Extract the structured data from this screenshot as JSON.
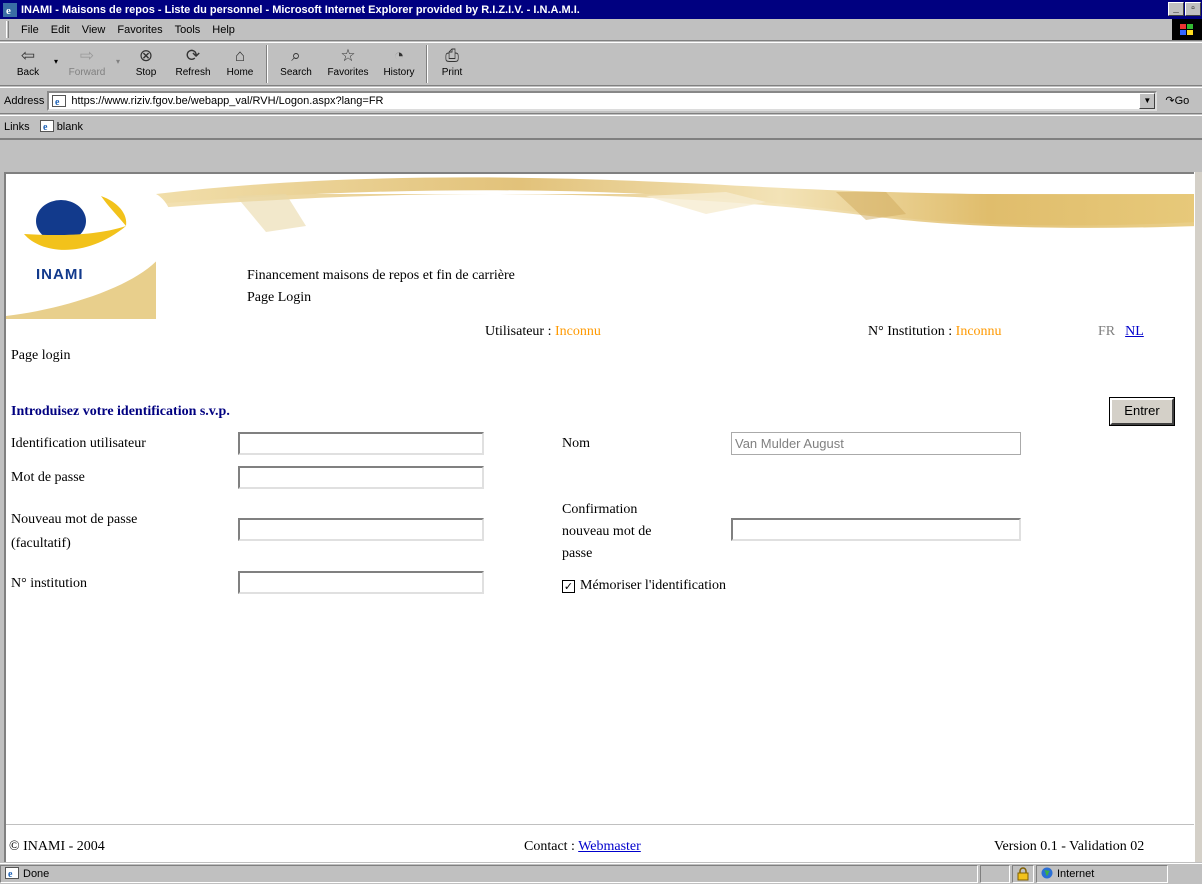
{
  "window": {
    "title": "INAMI - Maisons de repos - Liste du personnel - Microsoft Internet Explorer provided by R.I.Z.I.V. - I.N.A.M.I."
  },
  "menu": [
    "File",
    "Edit",
    "View",
    "Favorites",
    "Tools",
    "Help"
  ],
  "toolbar": {
    "back": "Back",
    "forward": "Forward",
    "stop": "Stop",
    "refresh": "Refresh",
    "home": "Home",
    "search": "Search",
    "favorites": "Favorites",
    "history": "History",
    "print": "Print"
  },
  "address": {
    "label": "Address",
    "url": "https://www.riziv.fgov.be/webapp_val/RVH/Logon.aspx?lang=FR",
    "go": "Go"
  },
  "links": {
    "label": "Links",
    "item": "blank"
  },
  "page": {
    "logo_text": "INAMI",
    "subtitle_1": "Financement maisons de repos et fin de carrière",
    "subtitle_2": "Page Login",
    "user_label": "Utilisateur : ",
    "user_value": "Inconnu",
    "inst_label": "N° Institution : ",
    "inst_value": "Inconnu",
    "lang_fr": "FR",
    "lang_nl": "NL",
    "page_title": "Page login",
    "intro": "Introduisez votre identification s.v.p.",
    "enter_button": "Entrer",
    "fields": {
      "user_id_label": "Identification utilisateur",
      "user_id_value": "",
      "password_label": "Mot de passe",
      "password_value": "",
      "new_password_label_1": "Nouveau mot de passe",
      "new_password_label_2": "(facultatif)",
      "new_password_value": "",
      "institution_label": "N° institution",
      "institution_value": "",
      "name_label": "Nom",
      "name_value": "Van Mulder August",
      "confirm_label_1": "Confirmation",
      "confirm_label_2": "nouveau mot de",
      "confirm_label_3": "passe",
      "confirm_value": "",
      "remember_label": "Mémoriser l'identification",
      "remember_checked": true
    },
    "footer": {
      "copyright": "© INAMI - 2004",
      "contact_label": "Contact : ",
      "contact_link": "Webmaster",
      "version": "Version 0.1 - Validation 02"
    }
  },
  "status": {
    "text": "Done",
    "zone": "Internet"
  },
  "colors": {
    "title_bar": "#000080",
    "accent_orange": "#ff9900",
    "intro_blue": "#000080",
    "link_blue": "#0000cc"
  }
}
